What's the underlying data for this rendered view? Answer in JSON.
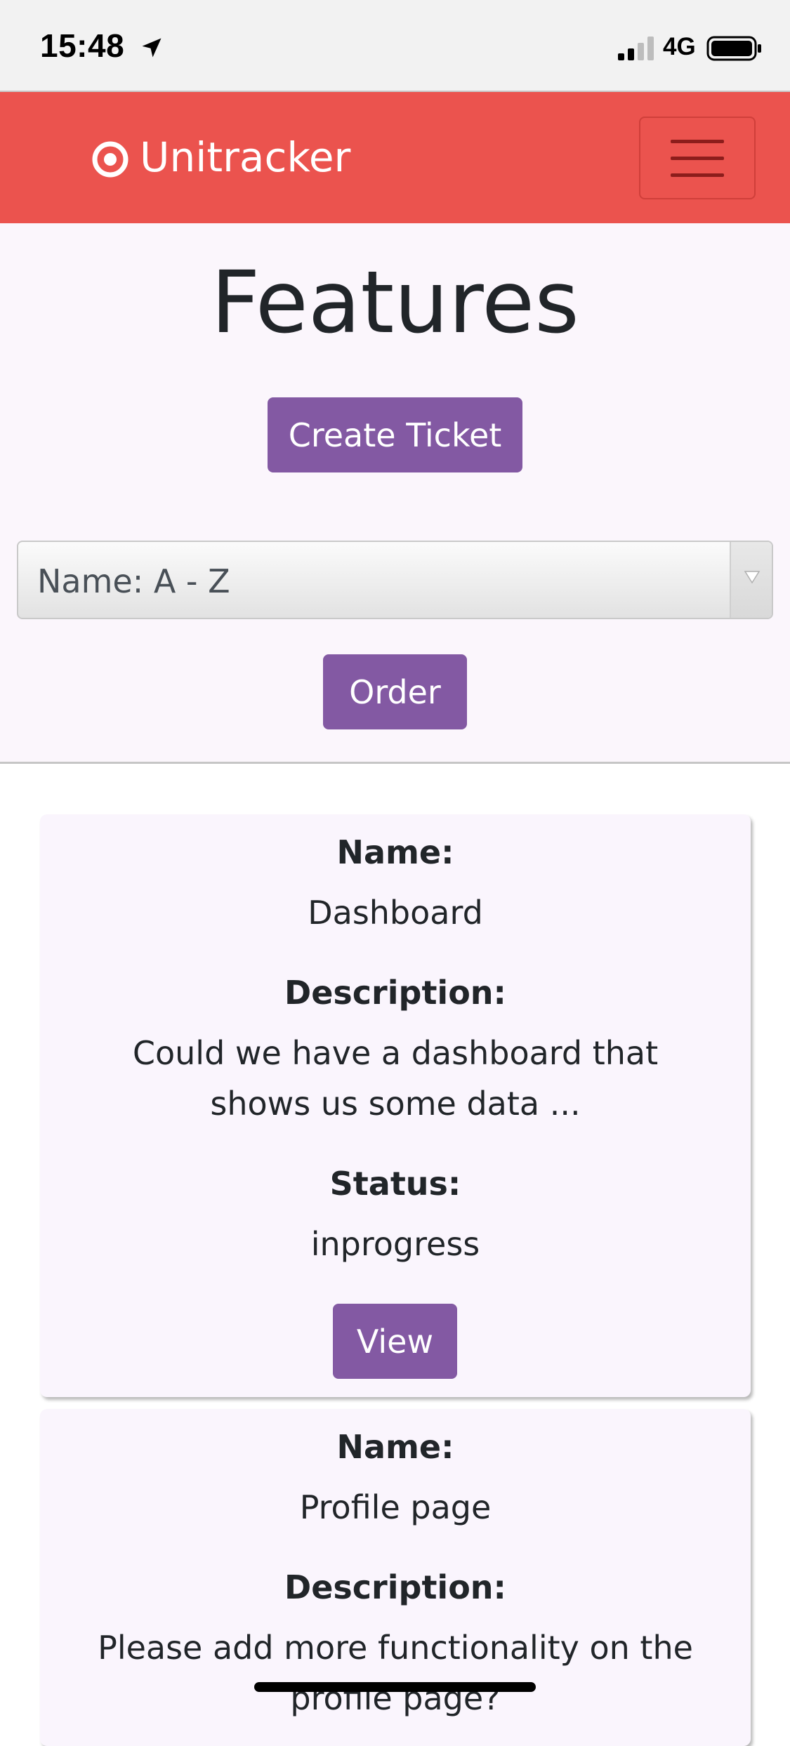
{
  "status_bar": {
    "time": "15:48",
    "network": "4G",
    "icons": [
      "location-arrow-icon",
      "signal-bars-icon",
      "battery-icon"
    ]
  },
  "navbar": {
    "brand": "Unitracker",
    "brand_icon": "target-icon",
    "menu_icon": "hamburger-menu-icon",
    "color": "#eb534e"
  },
  "header": {
    "title": "Features",
    "create_button": "Create Ticket",
    "sort_select": {
      "selected": "Name: A - Z"
    },
    "order_button": "Order"
  },
  "tickets": [
    {
      "name_label": "Name:",
      "name": "Dashboard",
      "description_label": "Description:",
      "description_line1": "Could we have a dashboard that",
      "description_line2": "shows us some data ...",
      "status_label": "Status:",
      "status": "inprogress",
      "view_button": "View"
    },
    {
      "name_label": "Name:",
      "name": "Profile page",
      "description_label": "Description:",
      "description_line1": "Please add more functionality on the",
      "description_line2": "profile page?"
    }
  ],
  "colors": {
    "accent_purple": "#8359a3",
    "navbar_red": "#eb534e",
    "card_bg": "#faf5fd"
  }
}
